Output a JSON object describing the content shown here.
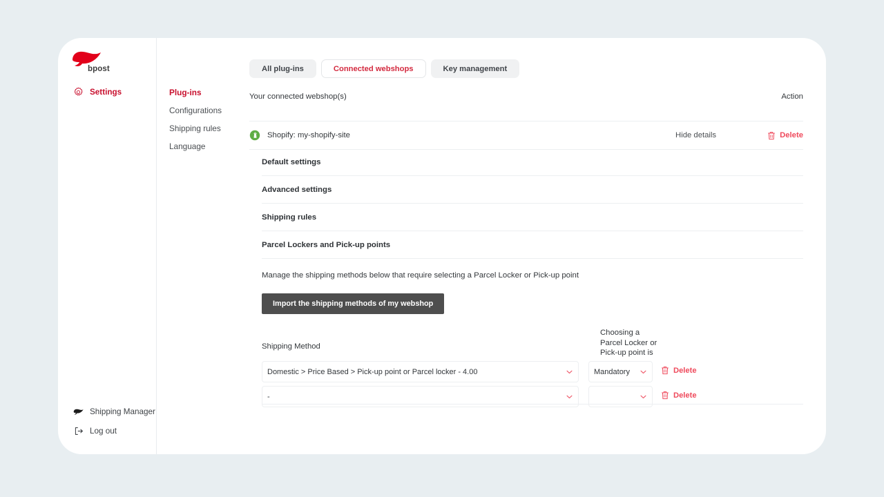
{
  "brand": {
    "name": "bpost",
    "logo_icon": "bpost-swoosh-icon",
    "accent_color": "#c8102e"
  },
  "rail": {
    "items": [
      {
        "id": "settings",
        "label": "Settings",
        "icon": "gear-icon",
        "active": true
      },
      {
        "id": "shipping-manager",
        "label": "Shipping Manager",
        "icon": "bpost-swoosh-icon",
        "active": false
      },
      {
        "id": "logout",
        "label": "Log out",
        "icon": "logout-icon",
        "active": false
      }
    ]
  },
  "subnav": {
    "items": [
      {
        "label": "Plug-ins",
        "active": true
      },
      {
        "label": "Configurations",
        "active": false
      },
      {
        "label": "Shipping rules",
        "active": false
      },
      {
        "label": "Language",
        "active": false
      }
    ]
  },
  "tabs": [
    {
      "label": "All plug-ins",
      "active": false
    },
    {
      "label": "Connected webshops",
      "active": true
    },
    {
      "label": "Key management",
      "active": false
    }
  ],
  "webshops": {
    "list_title": "Your connected webshop(s)",
    "action_column": "Action",
    "rows": [
      {
        "icon": "shopify-icon",
        "name": "Shopify: my-shopify-site",
        "details_toggle": "Hide details",
        "delete_label": "Delete",
        "delete_icon": "trash-icon"
      }
    ]
  },
  "accordions": [
    {
      "label": "Default settings",
      "expanded": false
    },
    {
      "label": "Advanced settings",
      "expanded": false
    },
    {
      "label": "Shipping rules",
      "expanded": false
    },
    {
      "label": "Parcel Lockers and Pick-up points",
      "expanded": true
    }
  ],
  "parcel_section": {
    "description": "Manage the shipping methods below that require selecting a Parcel Locker or Pick-up point",
    "import_button": "Import the shipping methods of my webshop"
  },
  "shipping_table": {
    "col_method": "Shipping Method",
    "col_choosing": "Choosing a Parcel Locker or Pick-up point is",
    "rows": [
      {
        "method": "Domestic > Price Based > Pick-up point or Parcel locker - 4.00",
        "choosing": "Mandatory",
        "delete_label": "Delete",
        "delete_icon": "trash-icon",
        "chevron_icon": "chevron-down-icon"
      },
      {
        "method": "-",
        "choosing": "",
        "delete_label": "Delete",
        "delete_icon": "trash-icon",
        "chevron_icon": "chevron-down-icon"
      }
    ]
  },
  "colors": {
    "page_background": "#e8eef1",
    "card_background": "#ffffff",
    "brand_red": "#c8102e",
    "link_red": "#ef4a5c",
    "button_dark": "#4e4e4e",
    "shopify_green": "#5fad45"
  }
}
